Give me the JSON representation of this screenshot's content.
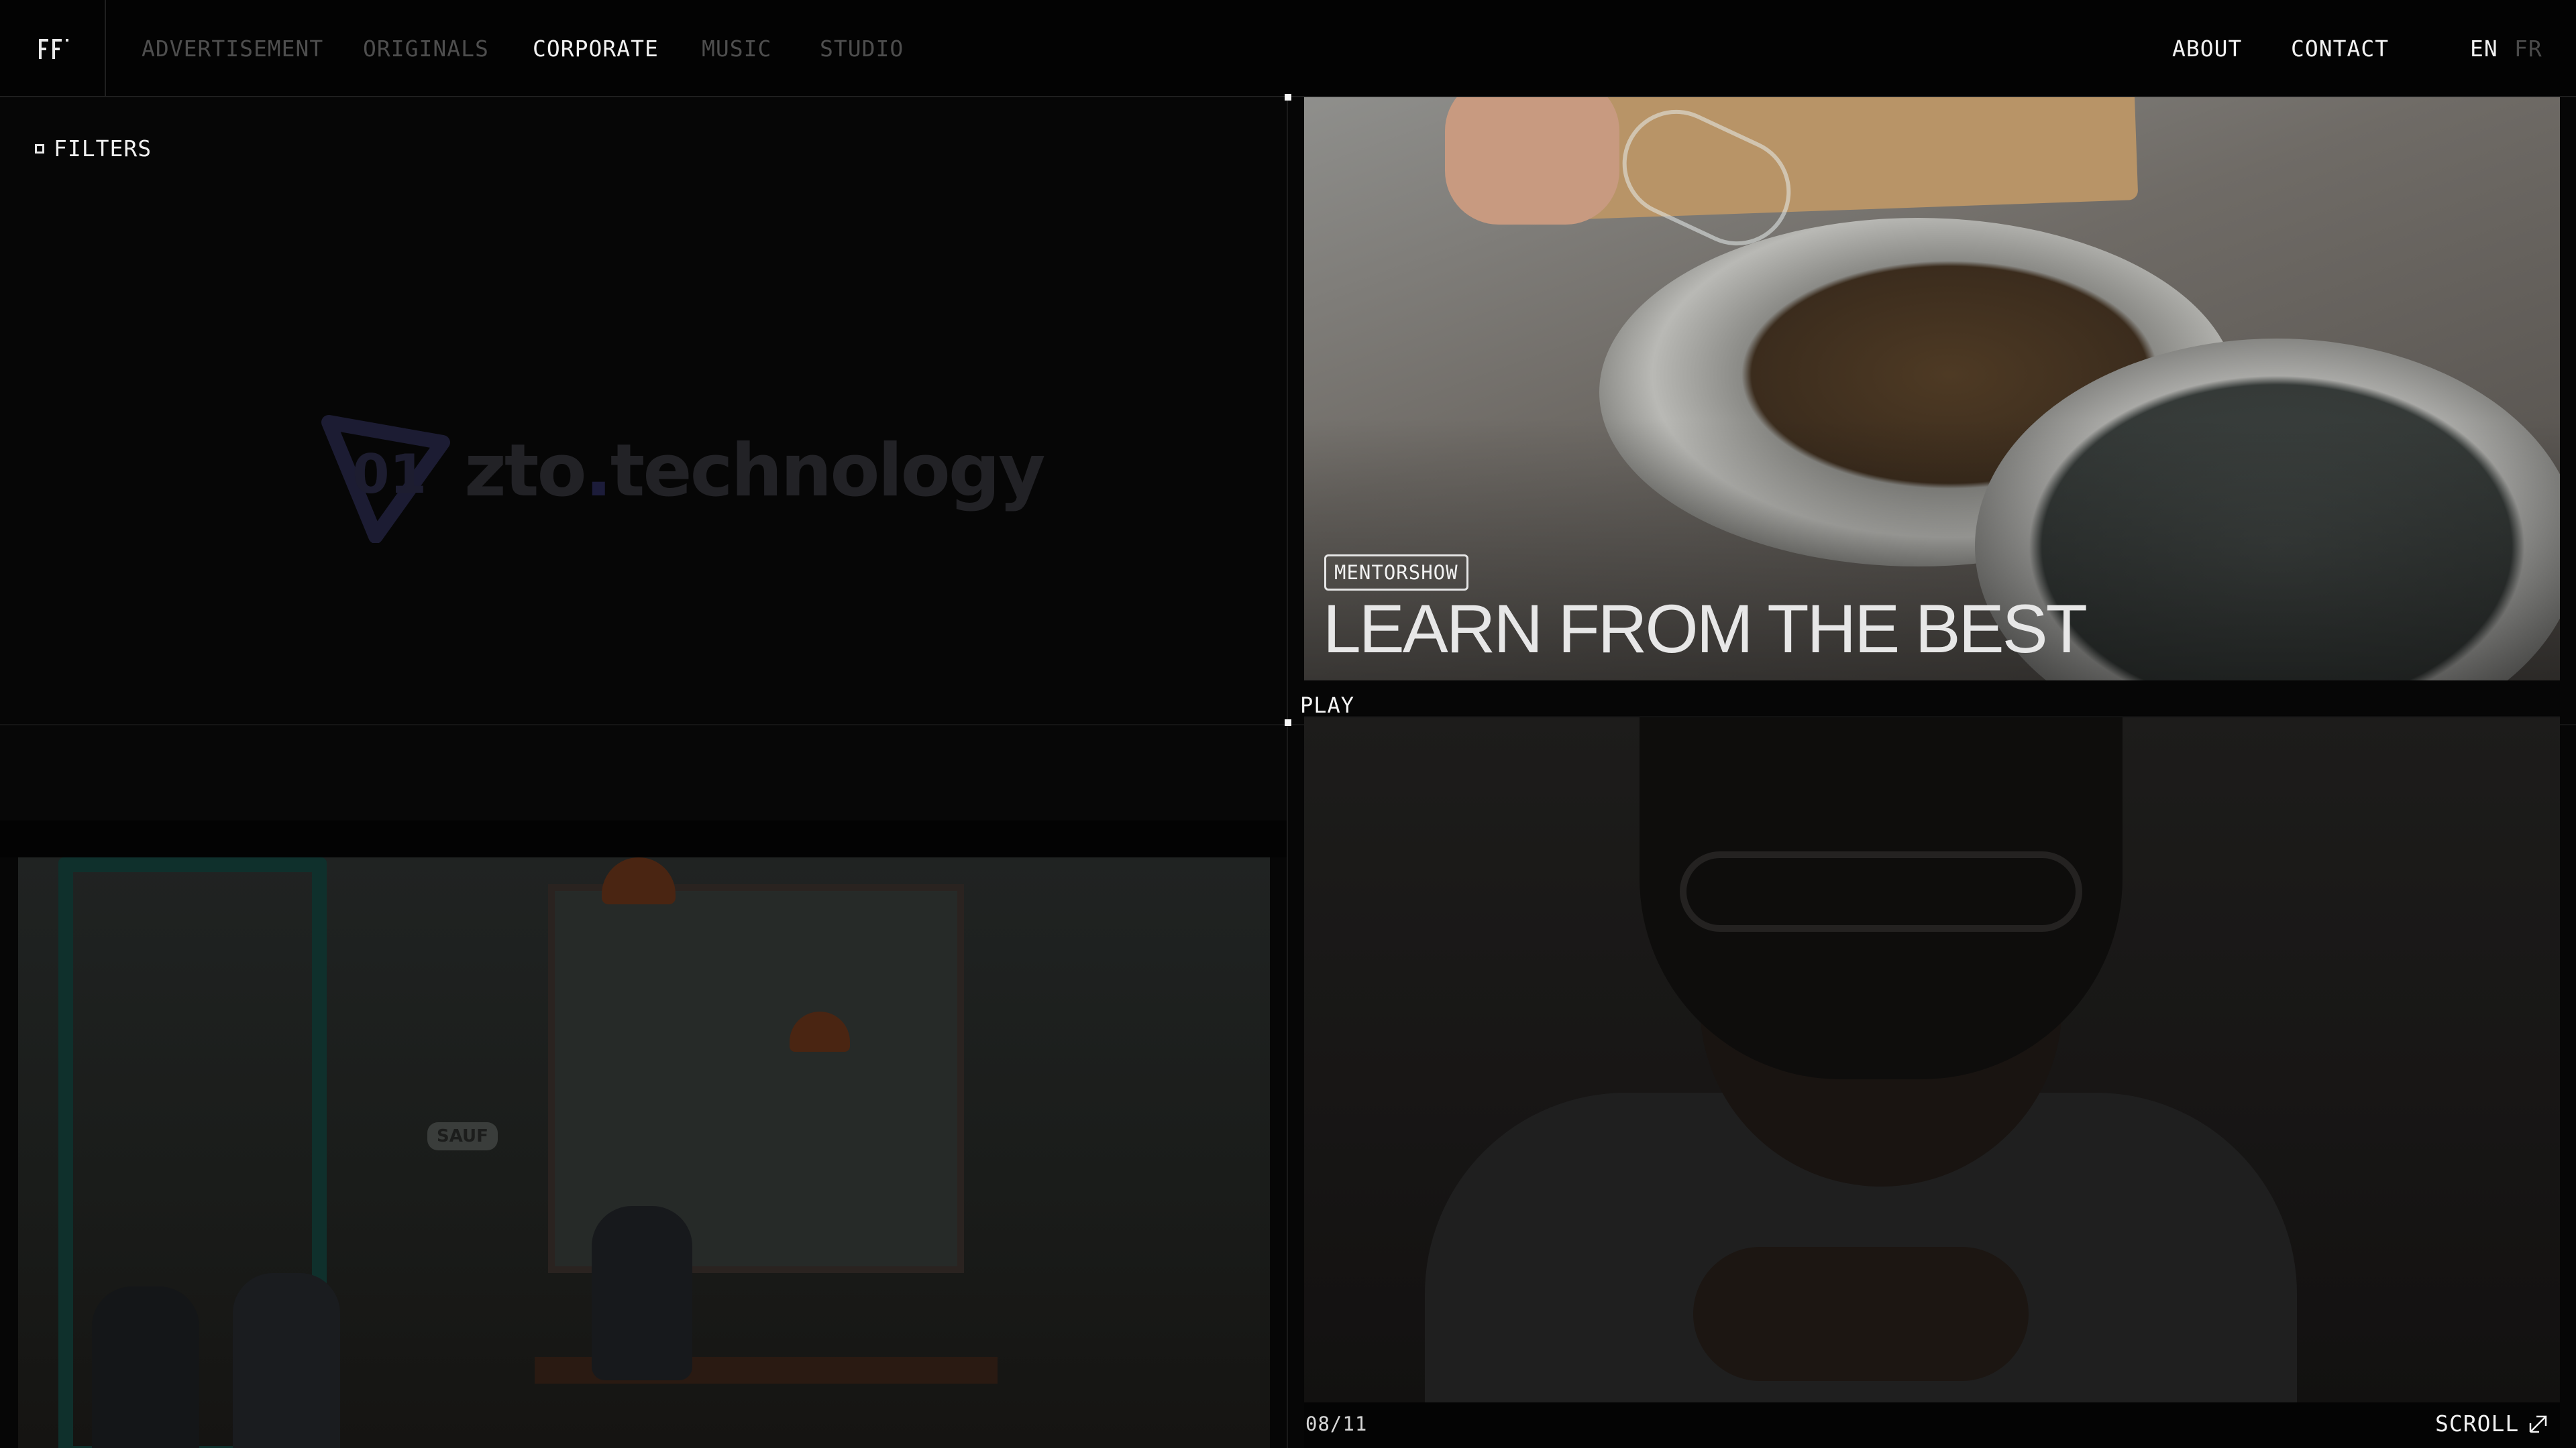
{
  "nav": {
    "categories": [
      {
        "label": "ADVERTISEMENT",
        "active": false
      },
      {
        "label": "ORIGINALS",
        "active": false
      },
      {
        "label": "CORPORATE",
        "active": true
      },
      {
        "label": "MUSIC",
        "active": false
      },
      {
        "label": "STUDIO",
        "active": false
      }
    ],
    "about": "ABOUT",
    "contact": "CONTACT",
    "languages": {
      "current": "EN",
      "other": "FR"
    }
  },
  "filters": {
    "label": "FILTERS"
  },
  "client_logo": {
    "prefix": "zto",
    "dot": ".",
    "suffix": "technology",
    "monogram": "01"
  },
  "featured": {
    "tag": "MENTORSHOW",
    "title": "LEARN FROM THE BEST",
    "play_label": "PLAY"
  },
  "cafe_sign": "SAUF",
  "pagination": {
    "counter": "08/11"
  },
  "scroll": {
    "label": "SCROLL"
  },
  "colors": {
    "background": "#060606",
    "text": "#f2f2f2",
    "inactive_nav": "#4e4e4e",
    "divider": "#1f1f1f"
  },
  "icons": {
    "logo": "ff-monogram-logo",
    "filters": "square-outline-icon",
    "scroll": "arrow-up-right-icon"
  }
}
